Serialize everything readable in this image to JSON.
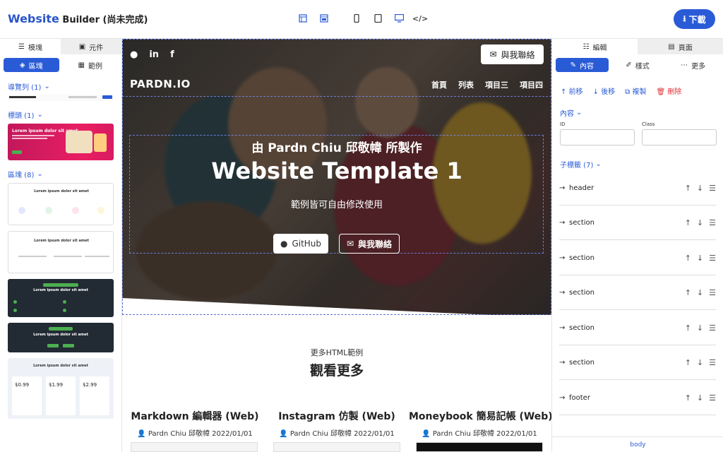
{
  "header": {
    "brand_main": "Website",
    "brand_rest": " Builder (尚未完成)",
    "download_label": "下載",
    "tools": [
      "layout-icon",
      "browser-icon",
      "mobile-icon",
      "tablet-icon",
      "desktop-icon",
      "code-icon"
    ]
  },
  "left": {
    "tabs": [
      "模塊",
      "元件"
    ],
    "pills": [
      "區塊",
      "範例"
    ],
    "sections": {
      "nav": "導覽列 (1)",
      "header": "標頭 (1)",
      "blocks": "區塊 (8)"
    },
    "thumb_text": "Lorem ipsum dolor sit amet"
  },
  "canvas": {
    "contact_label": "與我聯絡",
    "logo": "PARDN.IO",
    "nav": [
      "首頁",
      "列表",
      "項目三",
      "項目四"
    ],
    "subtitle": "由 Pardn Chiu 邱敬幃 所製作",
    "title": "Website Template 1",
    "desc": "範例皆可自由修改使用",
    "btn_github": "GitHub",
    "btn_contact": "與我聯絡",
    "more_sub": "更多HTML範例",
    "more_title": "觀看更多",
    "cards": [
      {
        "title": "Markdown 編輯器 (Web)",
        "meta": "Pardn Chiu 邱敬幃   2022/01/01"
      },
      {
        "title": "Instagram 仿製 (Web)",
        "meta": "Pardn Chiu 邱敬幃   2022/01/01"
      },
      {
        "title": "Moneybook 簡易記帳 (Web)",
        "meta": "Pardn Chiu 邱敬幃   2022/01/01"
      }
    ]
  },
  "right": {
    "tabs": [
      "編輯",
      "頁面"
    ],
    "pills": [
      "內容",
      "樣式",
      "更多"
    ],
    "actions": {
      "forward": "前移",
      "back": "後移",
      "copy": "複製",
      "delete": "刪除"
    },
    "content_label": "內容",
    "id_label": "ID",
    "class_label": "Class",
    "children_label": "子標籤 (7)",
    "children": [
      "header",
      "section",
      "section",
      "section",
      "section",
      "section",
      "footer"
    ],
    "footer_path": "body"
  },
  "colors": {
    "accent": "#2a5bd7",
    "danger": "#dd3333"
  }
}
